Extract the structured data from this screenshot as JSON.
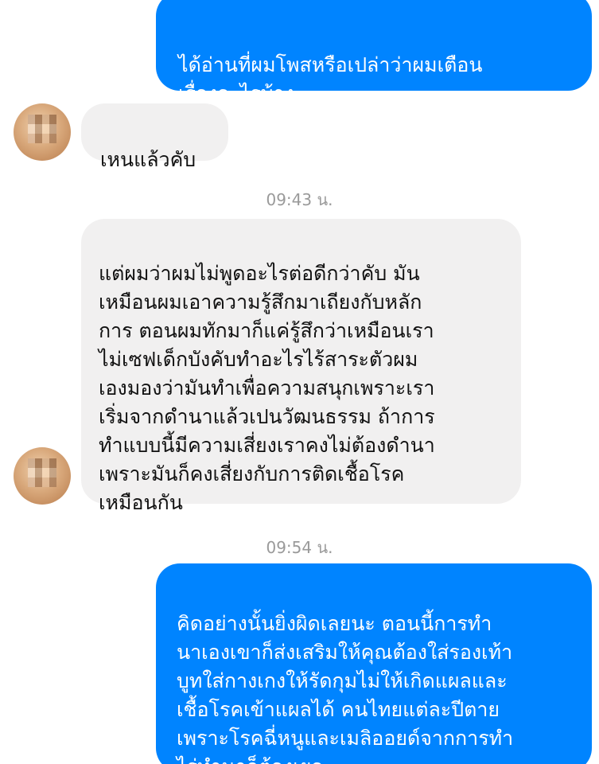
{
  "messages": {
    "m1": {
      "text": "ได้อ่านที่ผมโพสหรือเปล่าว่าผมเตือน\nเรื่องอะไรบ้าง"
    },
    "m2": {
      "text": "เหนแล้วคับ"
    },
    "ts1": "09:43 น.",
    "m3": {
      "text": "แต่ผมว่าผมไม่พูดอะไรต่อดีกว่าคับ มัน\nเหมือนผมเอาความรู้สึกมาเถียงกับหลัก\nการ ตอนผมทักมาก็แค่รู้สึกว่าเหมือนเรา\nไม่เซฟเด็กบังคับทำอะไรไร้สาระตัวผม\nเองมองว่ามันทำเพื่อความสนุกเพราะเรา\nเริ่มจากดำนาแล้วเปนวัฒนธรรม ถ้าการ\nทำแบบนี้มีความเสี่ยงเราคงไม่ต้องดำนา\nเพราะมันก็คงเสี่ยงกับการติดเชื้อโรค\nเหมือนกัน"
    },
    "ts2": "09:54 น.",
    "m4": {
      "text": "คิดอย่างนั้นยิ่งผิดเลยนะ ตอนนี้การทำ\nนาเองเขาก็ส่งเสริมให้คุณต้องใส่รองเท้า\nบูทใส่กางเกงให้รัดกุมไม่ให้เกิดแผลและ\nเชื้อโรคเข้าแผลได้ คนไทยแต่ละปีตาย\nเพราะโรคฉี่หนูและเมลิออยด์จากการทำ\nไร่ทำนาก็ต้องเยอะ"
    }
  },
  "colors": {
    "outgoing": "#0084ff",
    "incoming": "#f1f0f0",
    "timestamp": "#9a9a9a"
  }
}
